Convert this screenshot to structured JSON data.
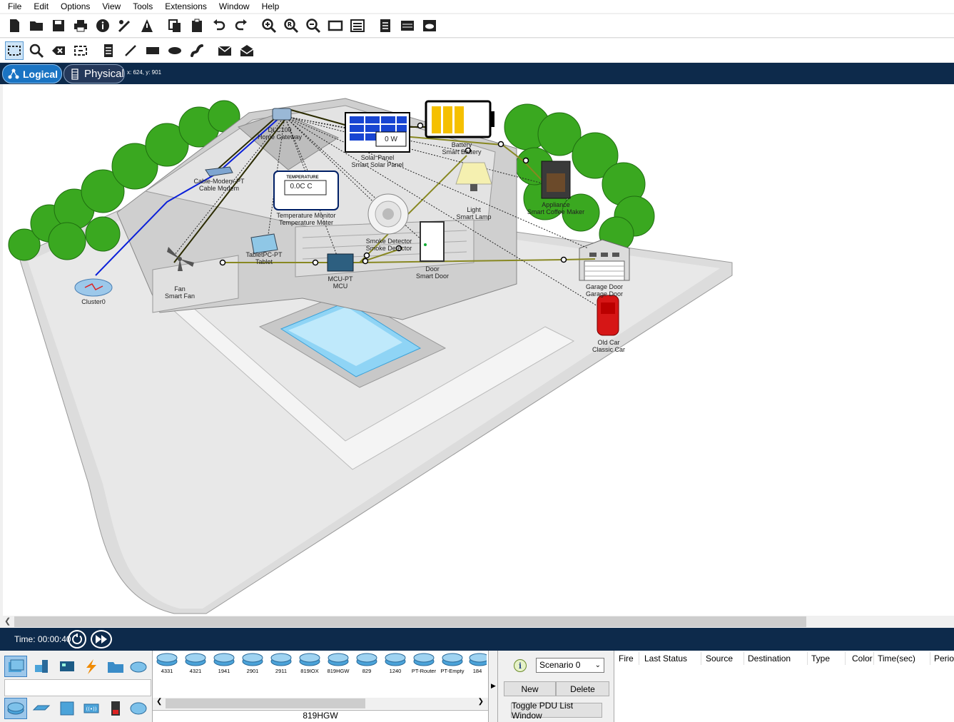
{
  "menu": [
    "File",
    "Edit",
    "Options",
    "View",
    "Tools",
    "Extensions",
    "Window",
    "Help"
  ],
  "toolbar_main": [
    "new-icon",
    "open-icon",
    "save-icon",
    "print-icon",
    "info-icon",
    "network-wizard-icon",
    "custom-device-icon",
    "copy-icon",
    "paste-icon",
    "undo-icon",
    "redo-icon",
    "zoom-in-icon",
    "zoom-reset-icon",
    "zoom-out-icon",
    "drawing-palette-icon",
    "custom-devices-dialog-icon",
    "pdu-icon",
    "viewport-icon",
    "cloud-icon"
  ],
  "toolbar_draw": [
    "select-icon",
    "inspect-icon",
    "delete-icon",
    "resize-icon",
    "note-icon",
    "line-icon",
    "rectangle-icon",
    "ellipse-icon",
    "freeform-icon",
    "simple-pdu-icon",
    "complex-pdu-icon"
  ],
  "tabs": {
    "logical": "Logical",
    "physical": "Physical"
  },
  "coords": "x: 624, y: 901",
  "workspace": {
    "devices": [
      {
        "name": "DLC100",
        "sub": "Home Gateway"
      },
      {
        "name": "Cable-Modem-PT",
        "sub": "Cable Modem"
      },
      {
        "name": "Solar Panel",
        "sub": "Smart Solar Panel"
      },
      {
        "name": "Battery",
        "sub": "Smart Battery"
      },
      {
        "name": "Temperature Monitor",
        "sub": "Temperature Meter"
      },
      {
        "name": "Light",
        "sub": "Smart Lamp"
      },
      {
        "name": "Appliance",
        "sub": "Smart Coffee Maker"
      },
      {
        "name": "Smoke Detector",
        "sub": "Smoke Detector"
      },
      {
        "name": "TabletPC-PT",
        "sub": "Tablet"
      },
      {
        "name": "Fan",
        "sub": "Smart Fan"
      },
      {
        "name": "MCU-PT",
        "sub": "MCU"
      },
      {
        "name": "Door",
        "sub": "Smart Door"
      },
      {
        "name": "Garage Door",
        "sub": "Garage Door"
      },
      {
        "name": "Old Car",
        "sub": "Classic Car"
      },
      {
        "name": "Cluster0",
        "sub": ""
      }
    ],
    "solar_reading": "0 W",
    "temp_panel_title": "TEMPERATURE",
    "temp_reading": "0.0C C"
  },
  "time": "Time: 00:00:40",
  "device_models": [
    "4331",
    "4321",
    "1941",
    "2901",
    "2911",
    "819IOX",
    "819HGW",
    "829",
    "1240",
    "PT-Router",
    "PT-Empty",
    "184"
  ],
  "selected_model": "819HGW",
  "scenario": {
    "select": "Scenario 0",
    "new": "New",
    "delete": "Delete",
    "toggle": "Toggle PDU List Window"
  },
  "pdu_columns": [
    "Fire",
    "Last Status",
    "Source",
    "Destination",
    "Type",
    "Color",
    "Time(sec)",
    "Periodic"
  ]
}
